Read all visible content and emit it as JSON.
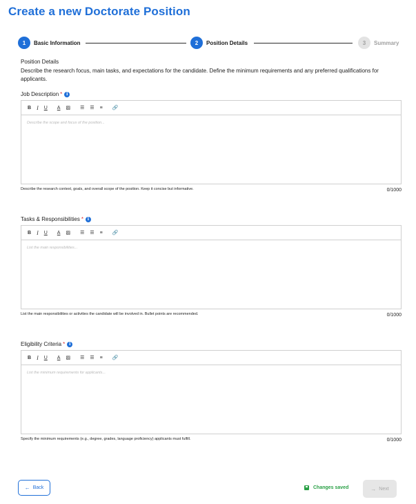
{
  "page": {
    "title": "Create a new Doctorate Position"
  },
  "stepper": {
    "steps": [
      {
        "number": "1",
        "label": "Basic Information",
        "state": "completed"
      },
      {
        "number": "2",
        "label": "Position Details",
        "state": "active"
      },
      {
        "number": "3",
        "label": "Summary",
        "state": "inactive"
      }
    ]
  },
  "section": {
    "title": "Position Details",
    "description": "Describe the research focus, main tasks, and expectations for the candidate. Define the minimum requirements and any preferred qualifications for applicants."
  },
  "toolbar": {
    "bold": "B",
    "italic": "I",
    "underline": "U",
    "text_color": "A",
    "highlight": "▨",
    "ordered_list": "☰",
    "bullet_list": "☰",
    "align": "≡",
    "link": "🔗"
  },
  "fields": [
    {
      "label": "Job Description",
      "required_mark": "*",
      "placeholder": "Describe the scope and focus of the position...",
      "help": "Describe the research context, goals, and overall scope of the position. Keep it concise but informative.",
      "counter": "0/1000"
    },
    {
      "label": "Tasks & Responsibilities",
      "required_mark": "*",
      "placeholder": "List the main responsibilities...",
      "help": "List the main responsibilities or activities the candidate will be involved in. Bullet points are recommended.",
      "counter": "0/1000"
    },
    {
      "label": "Eligibility Criteria",
      "required_mark": "*",
      "placeholder": "List the minimum requirements for applicants...",
      "help": "Specify the minimum requirements (e.g., degree, grades, language proficiency) applicants must fulfill.",
      "counter": "0/1000"
    }
  ],
  "footer": {
    "back_label": "Back",
    "saved_label": "Changes saved",
    "next_label": "Next"
  },
  "colors": {
    "accent": "#1f6fd8",
    "success": "#2aa046",
    "required": "#dd3333"
  }
}
